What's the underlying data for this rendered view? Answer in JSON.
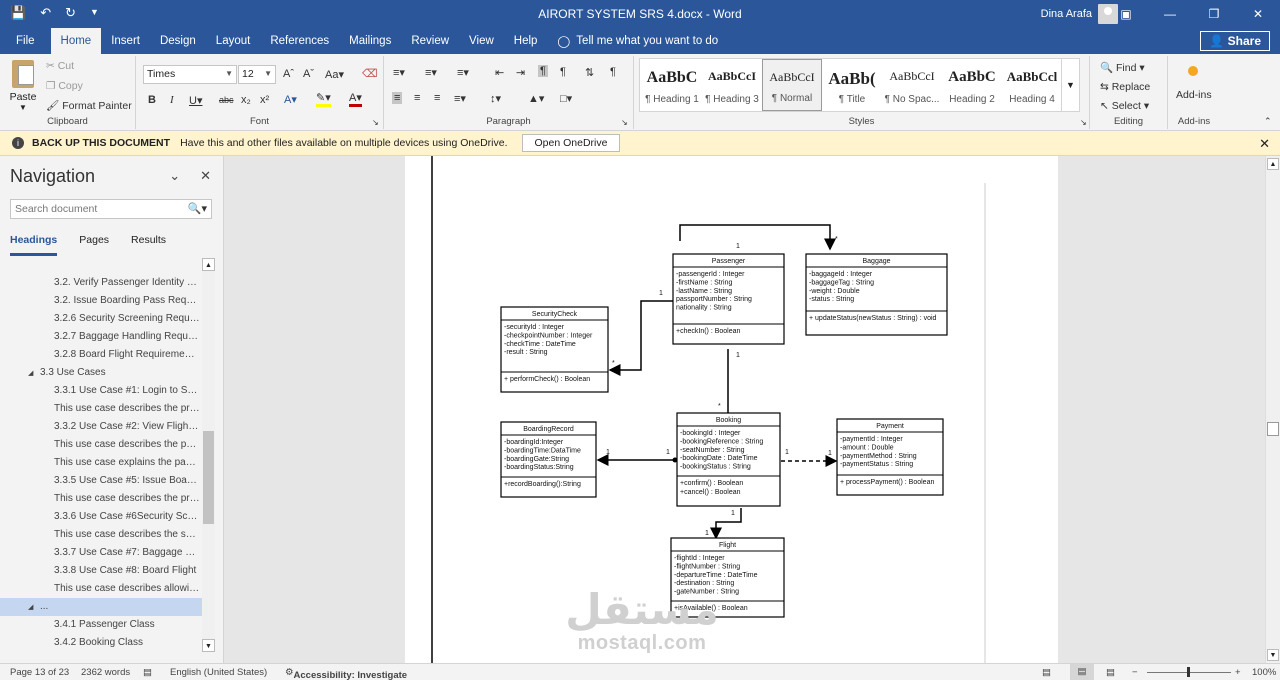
{
  "window": {
    "title": "AIRORT SYSTEM SRS 4.docx - Word",
    "user": "Dina Arafa"
  },
  "tabs": [
    "File",
    "Home",
    "Insert",
    "Design",
    "Layout",
    "References",
    "Mailings",
    "Review",
    "View",
    "Help"
  ],
  "tell_me": "Tell me what you want to do",
  "share": "Share",
  "clipboard": {
    "paste": "Paste",
    "cut": "Cut",
    "copy": "Copy",
    "format_painter": "Format Painter",
    "label": "Clipboard"
  },
  "font": {
    "name": "Times",
    "size": "12",
    "label": "Font"
  },
  "paragraph": {
    "label": "Paragraph"
  },
  "styles": {
    "label": "Styles",
    "items": [
      {
        "sample": "AaBbC",
        "name": "¶ Heading 1"
      },
      {
        "sample": "AaBbCcI",
        "name": "¶ Heading 3"
      },
      {
        "sample": "AaBbCcI",
        "name": "¶ Normal"
      },
      {
        "sample": "AaBb(",
        "name": "¶ Title"
      },
      {
        "sample": "AaBbCcI",
        "name": "¶ No Spac..."
      },
      {
        "sample": "AaBbC",
        "name": "Heading 2"
      },
      {
        "sample": "AaBbCcl",
        "name": "Heading 4"
      }
    ]
  },
  "editing": {
    "find": "Find",
    "replace": "Replace",
    "select": "Select",
    "label": "Editing"
  },
  "addins": {
    "button": "Add-ins",
    "label": "Add-ins"
  },
  "message_bar": {
    "title": "BACK UP THIS DOCUMENT",
    "text": "Have this and other files available on multiple devices using OneDrive.",
    "button": "Open OneDrive"
  },
  "navigation": {
    "title": "Navigation",
    "search_placeholder": "Search document",
    "tabs": [
      "Headings",
      "Pages",
      "Results"
    ],
    "items": [
      {
        "text": "3.2. Verify Passenger Identity R...",
        "level": 2
      },
      {
        "text": "3.2. Issue Boarding Pass Requir...",
        "level": 2
      },
      {
        "text": "3.2.6 Security Screening Requir...",
        "level": 2
      },
      {
        "text": "3.2.7 Baggage Handling Requir...",
        "level": 2
      },
      {
        "text": "3.2.8 Board Flight Requirement...",
        "level": 2
      },
      {
        "text": "3.3 Use Cases",
        "level": 1
      },
      {
        "text": "3.3.1 Use Case #1: Login to Syst...",
        "level": 2
      },
      {
        "text": "This use case describes the pro...",
        "level": 2
      },
      {
        "text": "3.3.2 Use Case #2: View Flight I...",
        "level": 2
      },
      {
        "text": "This use case describes the pas...",
        "level": 2
      },
      {
        "text": "This use case explains the pass...",
        "level": 2
      },
      {
        "text": "3.3.5 Use Case #5: Issue Boardi...",
        "level": 2
      },
      {
        "text": "This use case describes the pro...",
        "level": 2
      },
      {
        "text": "3.3.6 Use Case #6Security Scree...",
        "level": 2
      },
      {
        "text": "This use case describes the sec...",
        "level": 2
      },
      {
        "text": "3.3.7 Use Case #7: Baggage Ha...",
        "level": 2
      },
      {
        "text": "3.3.8 Use Case #8: Board Flight",
        "level": 2
      },
      {
        "text": "This use case describes allowin...",
        "level": 2
      },
      {
        "text": "...",
        "level": 1
      },
      {
        "text": "3.4.1 Passenger Class",
        "level": 2
      },
      {
        "text": "3.4.2 Booking Class",
        "level": 2
      }
    ]
  },
  "diagram": {
    "passenger": {
      "name": "Passenger",
      "attrs": [
        "-passengerId : Integer",
        "-firstName : String",
        "-lastName : String",
        "passportNumber : String",
        "nationality : String"
      ],
      "ops": [
        "+checkIn() : Boolean"
      ]
    },
    "baggage": {
      "name": "Baggage",
      "attrs": [
        "-baggageId : Integer",
        "-baggageTag : String",
        "-weight : Double",
        "-status : String"
      ],
      "ops": [
        "+ updateStatus(newStatus : String) : void"
      ]
    },
    "security": {
      "name": "SecurityCheck",
      "attrs": [
        "-securityId : Integer",
        "-checkpointNumber : Integer",
        "-checkTime : DateTime",
        "-result : String"
      ],
      "ops": [
        "+ performCheck() : Boolean"
      ]
    },
    "booking": {
      "name": "Booking",
      "attrs": [
        "-bookingId : Integer",
        "-bookingReference : String",
        "-seatNumber : String",
        "-bookingDate : DateTime",
        "-bookingStatus : String"
      ],
      "ops": [
        "+confirm() : Boolean",
        "+cancel() : Boolean"
      ]
    },
    "boarding": {
      "name": "BoardingRecord",
      "attrs": [
        "-boardingId:Integer",
        "-boardingTime:DataTime",
        "-boardingGate:String",
        "-boardingStatus:String"
      ],
      "ops": [
        "+recordBoarding():String"
      ]
    },
    "payment": {
      "name": "Payment",
      "attrs": [
        "-paymentId : Integer",
        "-amount : Double",
        "-paymentMethod : String",
        "-paymentStatus : String"
      ],
      "ops": [
        "+ processPayment() : Boolean"
      ]
    },
    "flight": {
      "name": "Flight",
      "attrs": [
        "-flightId : Integer",
        "-flightNumber : String",
        "-departureTime : DateTime",
        "-destination : String",
        "-gateNumber : String"
      ],
      "ops": [
        "+isAvailable() : Boolean"
      ]
    },
    "multiplicities": {
      "m1": "1",
      "m2": "*",
      "m3": "1",
      "m4": "*",
      "m5": "1",
      "m6": "*",
      "m7": "1",
      "m8": "1",
      "m9": "1",
      "m10": "1",
      "m11": "1",
      "m12": "1"
    }
  },
  "watermark": {
    "arabic": "مستقل",
    "latin": "mostaql.com"
  },
  "status": {
    "page": "Page 13 of 23",
    "words": "2362 words",
    "language": "English (United States)",
    "accessibility": "Accessibility: Investigate",
    "zoom": "100%"
  }
}
